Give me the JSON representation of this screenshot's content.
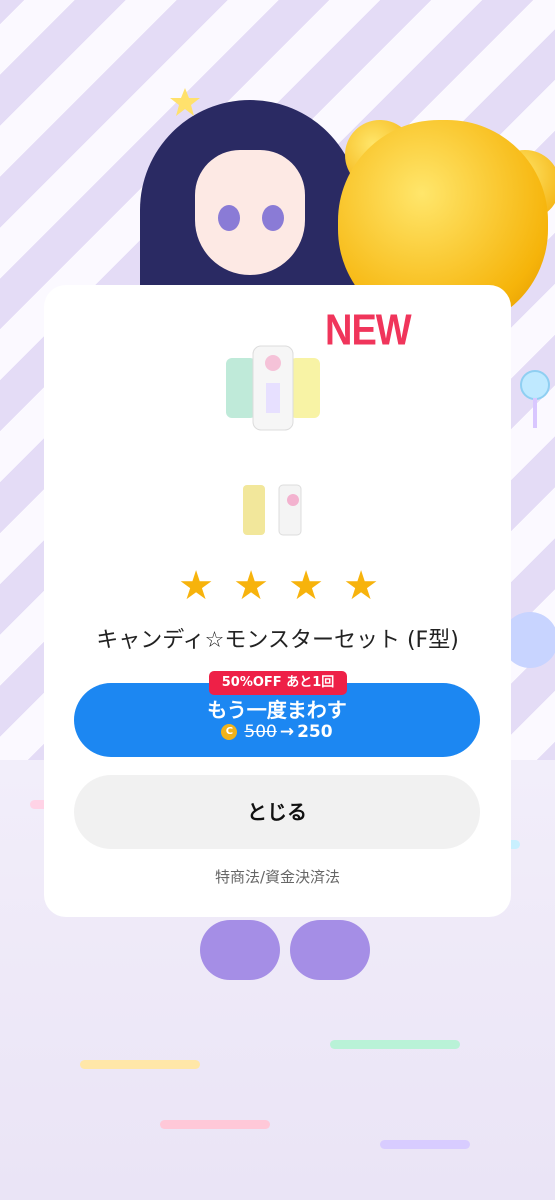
{
  "modal": {
    "new_badge": "NEW",
    "rarity_stars": 4,
    "item_name": "キャンディ☆モンスターセット (F型)",
    "discount_badge": "50%OFF あと1回",
    "spin_button": {
      "label": "もう一度まわす",
      "coin_icon": "coin-icon",
      "old_price": "500",
      "arrow": "→",
      "new_price": "250"
    },
    "close_button": "とじる",
    "legal_link": "特商法/資金決済法"
  },
  "colors": {
    "accent_blue": "#1c87f2",
    "discount_red": "#ee2047",
    "new_pink": "#f0355b",
    "star_gold": "#f7b30c"
  },
  "icons": [
    "star-icon",
    "coin-icon",
    "outfit-item-icon",
    "shoes-item-icon"
  ]
}
